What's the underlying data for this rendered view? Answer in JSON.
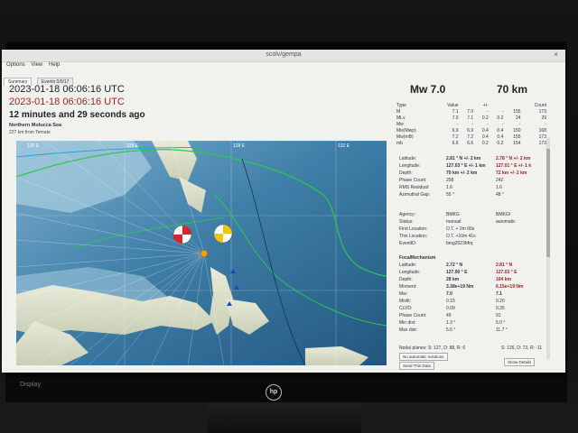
{
  "window": {
    "title": "scolv/gempa",
    "close_glyph": "×"
  },
  "menu": [
    "Options",
    "View",
    "Help"
  ],
  "tabs": [
    "Summary",
    "Events 0/0/17"
  ],
  "event": {
    "origin_time_utc": "2023-01-18 06:06:16 UTC",
    "origin_time_local": "2023-01-18 06:06:16 UTC",
    "elapsed": "12 minutes and 29 seconds ago",
    "region": "Northern Molucca Sea",
    "distance": "227 km from Ternate",
    "magnitude_title": "Mw 7.0",
    "depth_title": "70 km"
  },
  "magnitude_table": {
    "headers": [
      "Type",
      "Value",
      "",
      "+/-",
      "",
      "Count"
    ],
    "rows": [
      [
        "M",
        "7.1",
        "7.0",
        "-",
        "-",
        "155",
        "173"
      ],
      [
        "MLv",
        "7.0",
        "7.1",
        "0.2",
        "0.2",
        "24",
        "29"
      ],
      [
        "Mw",
        "-",
        "-",
        "-",
        "-",
        "-",
        "-"
      ],
      [
        "Mw(Mwp)",
        "6.9",
        "6.9",
        "0.4",
        "0.4",
        "150",
        "168"
      ],
      [
        "Mw(mB)",
        "7.2",
        "7.2",
        "0.4",
        "0.4",
        "155",
        "173"
      ],
      [
        "mb",
        "6.6",
        "6.6",
        "0.2",
        "0.2",
        "154",
        "173"
      ]
    ]
  },
  "location": {
    "rows": [
      {
        "label": "Latitude:",
        "a": "2.81 ° N  +/-  2 km",
        "b": "2.78 ° N  +/-  2 km"
      },
      {
        "label": "Longitude:",
        "a": "127.03 ° E  +/-  1 km",
        "b": "127.01 ° E  +/-  1 k"
      },
      {
        "label": "Depth:",
        "a": "70 km  +/-  2 km",
        "b": "72 km  +/-  2 km"
      },
      {
        "label": "Phase Count:",
        "a": "258",
        "b": "242"
      },
      {
        "label": "RMS Residual:",
        "a": "1.6",
        "b": "1.6"
      },
      {
        "label": "Azimuthal Gap:",
        "a": "55 °",
        "b": "48 °"
      }
    ]
  },
  "agency": {
    "rows": [
      {
        "label": "Agency:",
        "a": "BMKG",
        "b": "BMKGI"
      },
      {
        "label": "Status:",
        "a": "manual",
        "b": "automatic"
      },
      {
        "label": "First Location:",
        "a": "O.T. + 2m 00s",
        "b": ""
      },
      {
        "label": "This Location:",
        "a": "O.T. +10m 41s",
        "b": ""
      },
      {
        "label": "EventID:",
        "a": "bmg2023bfrq",
        "b": ""
      }
    ]
  },
  "focal": {
    "title": "FocalMechanism",
    "rows": [
      {
        "label": "Latitude:",
        "a": "2.72 ° N",
        "b": "2.81 ° N"
      },
      {
        "label": "Longitude:",
        "a": "127.00 ° E",
        "b": "127.03 ° E"
      },
      {
        "label": "Depth:",
        "a": "28 km",
        "b": "104 km"
      },
      {
        "label": "Moment:",
        "a": "3.38e+19 Nm",
        "b": "6.15e+19 Nm"
      },
      {
        "label": "Mw:",
        "a": "7.0",
        "b": "7.1"
      },
      {
        "label": "Misfit:",
        "a": "0.15",
        "b": "0.20"
      },
      {
        "label": "CLVD:",
        "a": "0.09",
        "b": "0.35"
      },
      {
        "label": "Phase Count:",
        "a": "49",
        "b": "91"
      },
      {
        "label": "Min dist:",
        "a": "1.3 °",
        "b": "5.0 °"
      },
      {
        "label": "Max dist:",
        "a": "5.6 °",
        "b": "11.7 °"
      }
    ],
    "nodal_a": "Nodal planes: S: 127, D: 88, R: 6",
    "nodal_b": "S: 126, D: 73, R: -11"
  },
  "buttons": {
    "no_auto": "No automatic solutions",
    "send": "Send This Data",
    "show_details": "Show Details"
  },
  "map": {
    "graticule_labels": [
      "120 E",
      "125 E",
      "128 E",
      "132 E"
    ],
    "colors": {
      "ocean": "#2f6d97",
      "land": "#d8dcc8",
      "epicenter": "#e6a21c",
      "mech_red": "#d9242b",
      "mech_yellow": "#f2c511"
    }
  },
  "monitor": {
    "brand": "hp",
    "model": "Display"
  }
}
